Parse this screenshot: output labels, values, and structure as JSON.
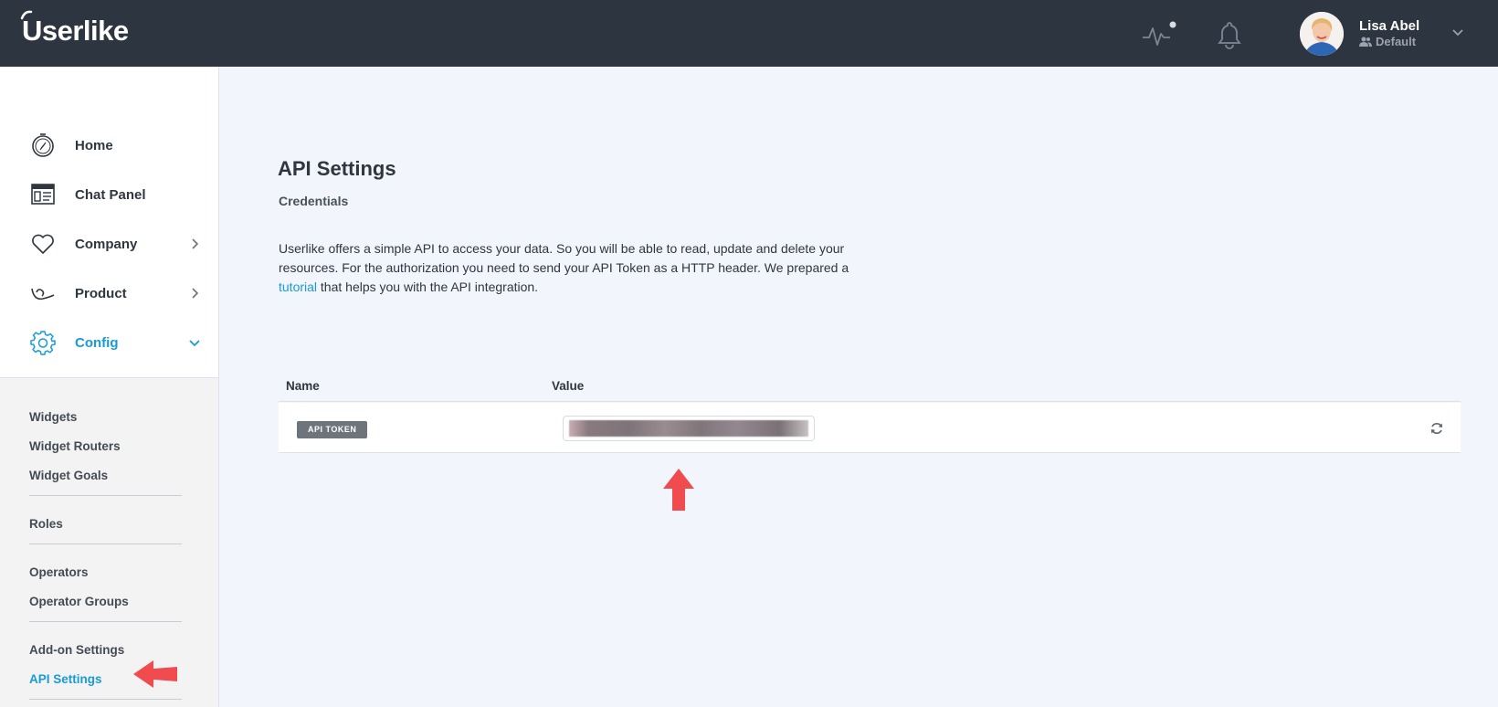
{
  "header": {
    "logo_text": "Userlike",
    "user": {
      "name": "Lisa Abel",
      "role": "Default"
    }
  },
  "sidebar": {
    "nav": [
      {
        "label": "Home",
        "icon": "compass-icon"
      },
      {
        "label": "Chat Panel",
        "icon": "chat-panel-icon"
      },
      {
        "label": "Company",
        "icon": "heart-icon",
        "chevron": "right"
      },
      {
        "label": "Product",
        "icon": "product-icon",
        "chevron": "right"
      },
      {
        "label": "Config",
        "icon": "gear-icon",
        "chevron": "down",
        "active": true
      }
    ],
    "subnav": [
      {
        "label": "Widgets"
      },
      {
        "label": "Widget Routers"
      },
      {
        "label": "Widget Goals"
      },
      {
        "label": "Roles"
      },
      {
        "label": "Operators"
      },
      {
        "label": "Operator Groups"
      },
      {
        "label": "Add-on Settings"
      },
      {
        "label": "API Settings",
        "active": true
      }
    ]
  },
  "main": {
    "title": "API Settings",
    "subtitle": "Credentials",
    "description_before": "Userlike offers a simple API to access your data. So you will be able to read, update and delete your resources. For the authorization you need to send your API Token as a HTTP header. We prepared a ",
    "description_link": "tutorial",
    "description_after": " that helps you with the API integration.",
    "table": {
      "headers": {
        "name": "Name",
        "value": "Value"
      },
      "rows": [
        {
          "name": "API TOKEN"
        }
      ]
    }
  },
  "colors": {
    "accent": "#1a9ad6",
    "topbar": "#2d3540",
    "annotation": "#f04c50"
  }
}
